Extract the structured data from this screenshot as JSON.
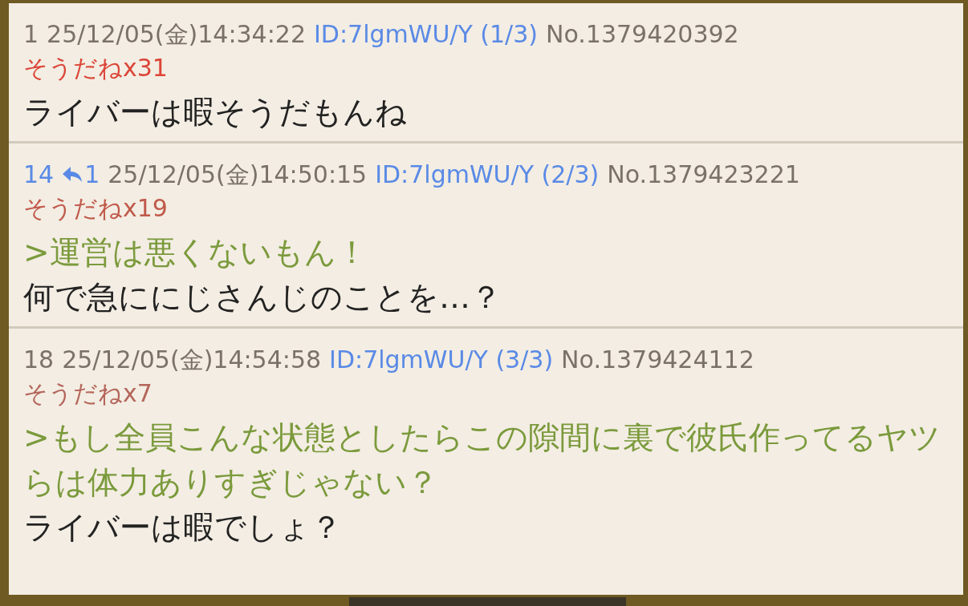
{
  "posts": [
    {
      "number": "1",
      "date": "25/12/05(金)14:34:22",
      "id": "ID:7lgmWU/Y (1/3)",
      "no": "No.1379420392",
      "sodane": "そうだねx31",
      "color": "#dc4538",
      "lines": [
        {
          "kind": "text",
          "text": "ライバーは暇そうだもんね"
        }
      ]
    },
    {
      "number": "14",
      "reply_ref": "1",
      "date": "25/12/05(金)14:50:15",
      "id": "ID:7lgmWU/Y (2/3)",
      "no": "No.1379423221",
      "sodane": "そうだねx19",
      "color": "#c0594a",
      "lines": [
        {
          "kind": "quote",
          "text": ">運営は悪くないもん！"
        },
        {
          "kind": "text",
          "text": "何で急ににじさんじのことを…？"
        }
      ]
    },
    {
      "number": "18",
      "date": "25/12/05(金)14:54:58",
      "id": "ID:7lgmWU/Y (3/3)",
      "no": "No.1379424112",
      "sodane": "そうだねx7",
      "color": "#b5655a",
      "lines": [
        {
          "kind": "quote",
          "text": ">もし全員こんな状態としたらこの隙間に裏で彼氏作ってるヤツらは体力ありすぎじゃない？"
        },
        {
          "kind": "text",
          "text": "ライバーは暇でしょ？"
        }
      ]
    }
  ]
}
